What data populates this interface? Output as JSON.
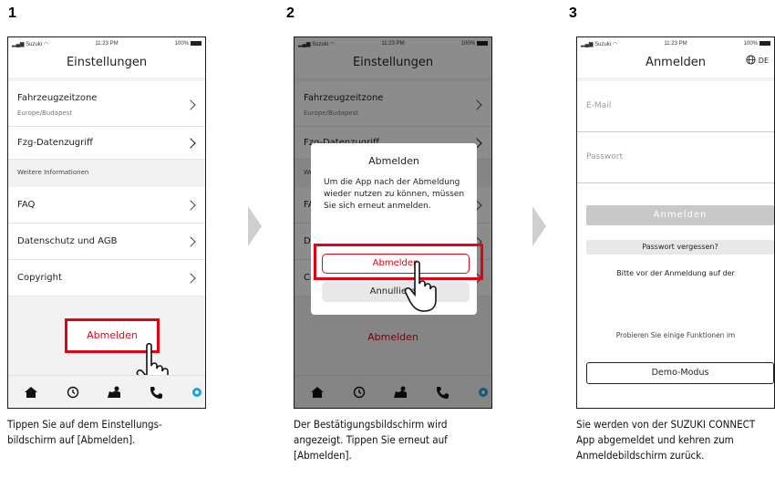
{
  "steps": [
    {
      "number": "1",
      "caption": "Tippen Sie auf dem Einstellungs-bildschirm auf [Abmelden].",
      "screen": {
        "status": {
          "carrier": "Suzuki",
          "time": "11:23 PM",
          "battery": "100%"
        },
        "title": "Einstellungen",
        "rows": [
          {
            "label": "Fahrzeugzeitzone",
            "sub": "Europe/Budapest"
          },
          {
            "label": "Fzg-Datenzugriff"
          },
          {
            "section": "Weitere Informationen"
          },
          {
            "label": "FAQ"
          },
          {
            "label": "Datenschutz und AGB"
          },
          {
            "label": "Copyright"
          }
        ],
        "logout_label": "Abmelden",
        "tabs": [
          "home-icon",
          "history-icon",
          "map-icon",
          "phone-icon",
          "settings-icon"
        ]
      }
    },
    {
      "number": "2",
      "caption": "Der Bestätigungsbildschirm wird angezeigt. Tippen Sie erneut auf [Abmelden].",
      "screen": {
        "status": {
          "carrier": "Suzuki",
          "time": "11:23 PM",
          "battery": "100%"
        },
        "title": "Einstellungen",
        "rows": [
          {
            "label": "Fahrzeugzeitzone",
            "sub": "Europe/Budapest"
          },
          {
            "label": "Fzg-Datenzugriff"
          },
          {
            "section": "We"
          },
          {
            "label": "FA"
          },
          {
            "label": "Da"
          },
          {
            "label": "Co"
          }
        ],
        "logout_label": "Abmelden",
        "dialog": {
          "title": "Abmelden",
          "message": "Um die App nach der Abmeldung wieder nutzen zu können, müssen Sie sich erneut anmelden.",
          "confirm_label": "Abmelden",
          "cancel_label": "Annullieren"
        }
      }
    },
    {
      "number": "3",
      "caption": "Sie werden von der SUZUKI CONNECT App abgemeldet und kehren zum Anmeldebildschirm zurück.",
      "screen": {
        "status": {
          "carrier": "Suzuki",
          "time": "11:23 PM",
          "battery": "100%"
        },
        "title": "Anmelden",
        "language": "DE",
        "email_placeholder": "E-Mail",
        "password_placeholder": "Passwort",
        "login_label": "Anmelden",
        "forgot_label": "Passwort vergessen?",
        "notice_text": "Bitte vor der Anmeldung auf der",
        "demo_hint": "Probieren Sie einige Funktionen im",
        "demo_label": "Demo-Modus"
      }
    }
  ],
  "colors": {
    "accent": "#e60012",
    "active_tab": "#1da1e6",
    "highlight_box": "#e60012"
  }
}
